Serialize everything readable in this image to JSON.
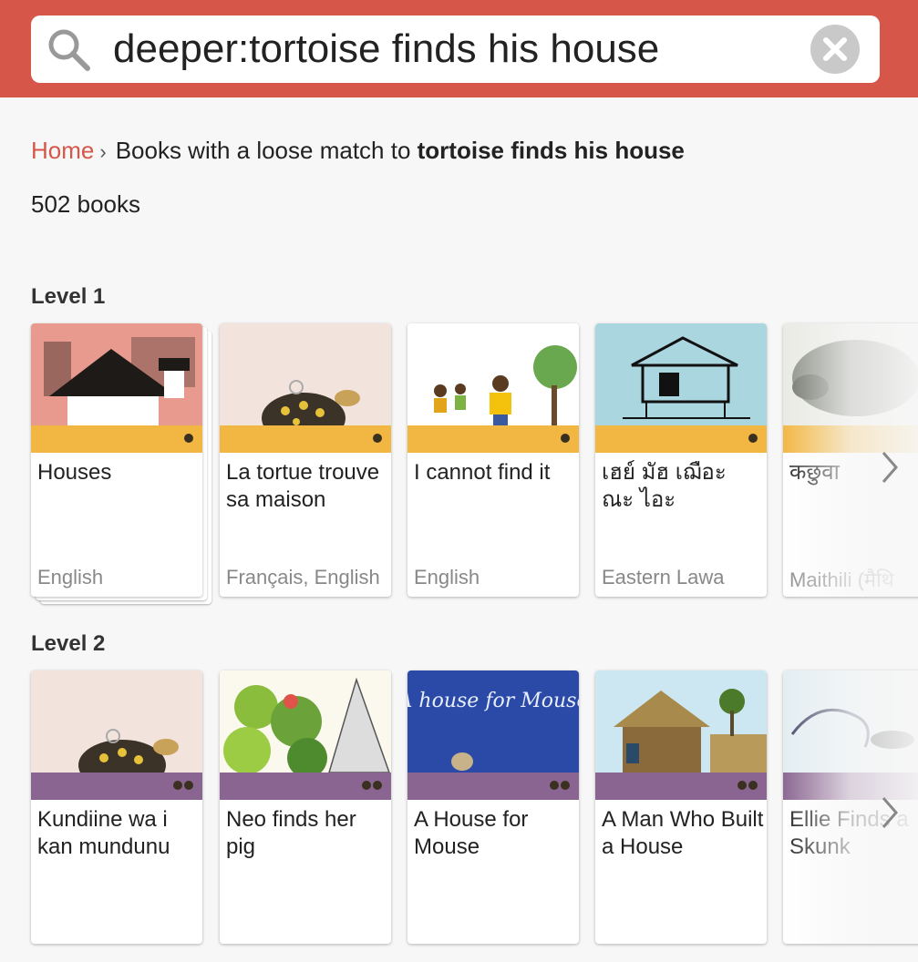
{
  "search": {
    "query": "deeper:tortoise finds his house"
  },
  "breadcrumb": {
    "home": "Home",
    "separator": "›",
    "prefix": "Books with a loose match to ",
    "term": "tortoise finds his house"
  },
  "result_count": "502 books",
  "colors": {
    "header": "#d65649",
    "level1_band": "#f2b742",
    "level2_band": "#8a6591"
  },
  "levels": [
    {
      "title": "Level 1",
      "books": [
        {
          "title": "Houses",
          "language": "English"
        },
        {
          "title": "La tortue trouve sa maison",
          "language": "Français, English"
        },
        {
          "title": "I cannot find it",
          "language": "English"
        },
        {
          "title": "เฮย์ มัฮ เฌือะ ณะ ไอะ",
          "language": "Eastern Lawa"
        },
        {
          "title": "कछुवा",
          "language": "Maithili (मैथि"
        }
      ]
    },
    {
      "title": "Level 2",
      "books": [
        {
          "title": "Kundiine wa i kan mundunu",
          "language": ""
        },
        {
          "title": "Neo finds her pig",
          "language": ""
        },
        {
          "title": "A House for Mouse",
          "language": "",
          "cover_text": "A house for Mouse"
        },
        {
          "title": "A Man Who Built a House",
          "language": ""
        },
        {
          "title": "Ellie Finds a Skunk",
          "language": ""
        }
      ]
    }
  ]
}
